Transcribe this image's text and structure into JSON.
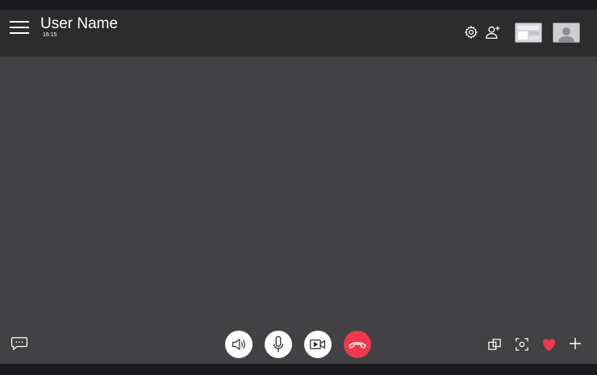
{
  "header": {
    "user_name": "User Name",
    "call_time": "16:15"
  },
  "icons": {
    "menu": "hamburger-menu-icon",
    "settings": "gear-icon",
    "add_user": "add-user-icon",
    "chat": "chat-bubble-icon",
    "speaker": "speaker-icon",
    "mic": "microphone-icon",
    "video": "video-camera-icon",
    "end_call": "phone-hangup-icon",
    "pip": "picture-in-picture-icon",
    "screenshot": "screenshot-capture-icon",
    "heart": "heart-icon",
    "plus": "plus-icon"
  },
  "colors": {
    "background": "#424244",
    "header": "#2c2c2d",
    "frame": "#1b1b1f",
    "end_call": "#f0394b",
    "heart": "#f0394b",
    "control_button": "#ffffff"
  }
}
